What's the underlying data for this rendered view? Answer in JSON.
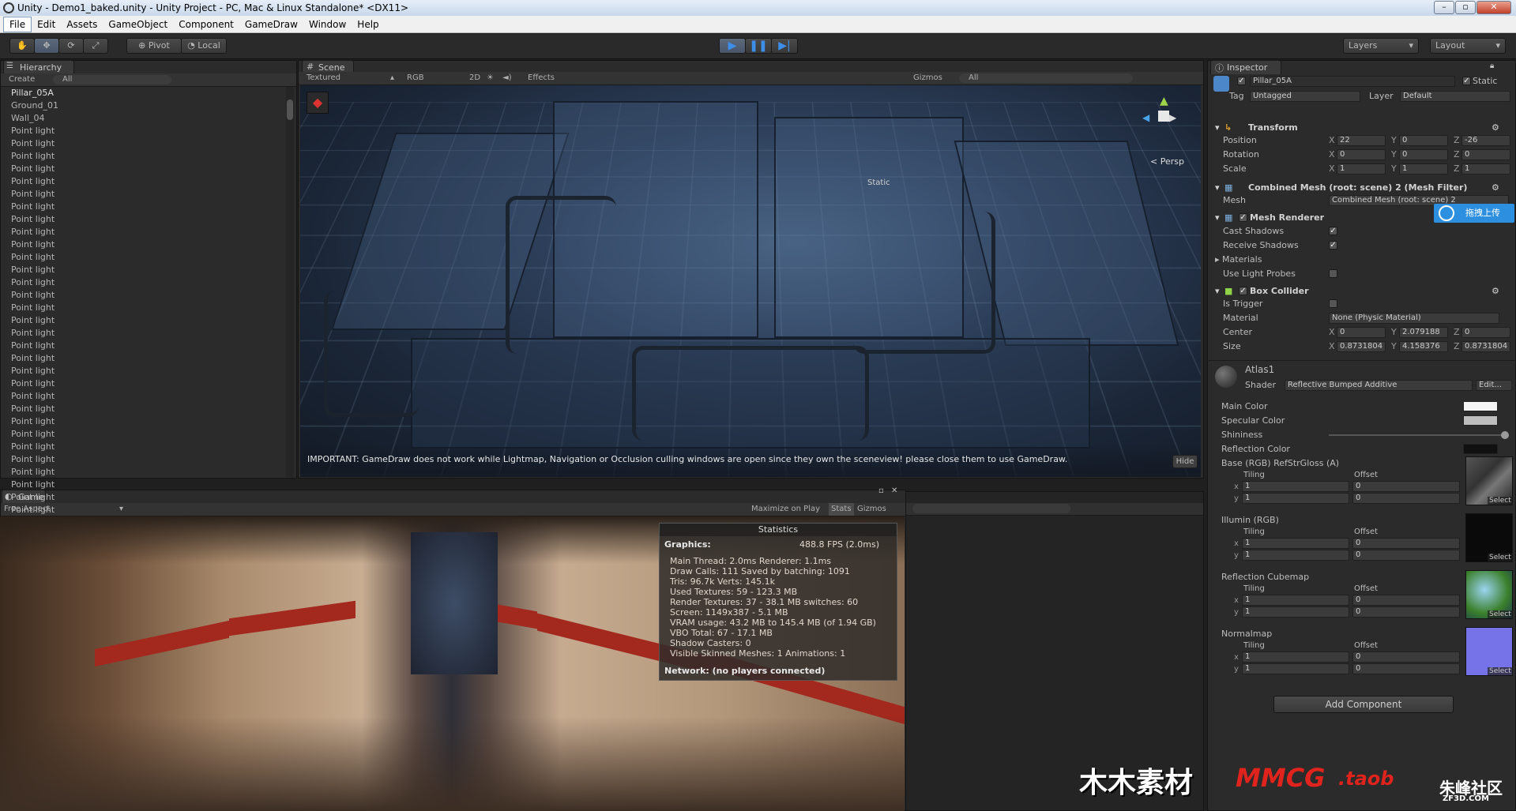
{
  "window": {
    "title": "Unity - Demo1_baked.unity - Unity Project - PC, Mac & Linux Standalone* <DX11>",
    "controls": [
      "–",
      "▫",
      "✕"
    ]
  },
  "menu": [
    "File",
    "Edit",
    "Assets",
    "GameObject",
    "Component",
    "GameDraw",
    "Window",
    "Help"
  ],
  "toolbar": {
    "pivot": "Pivot",
    "local": "Local",
    "layers": "Layers",
    "layout": "Layout"
  },
  "hierarchy": {
    "tab": "Hierarchy",
    "create": "Create",
    "search_placeholder": "All",
    "items": [
      "Pillar_05A",
      "Ground_01",
      "Wall_04",
      "Point light",
      "Point light",
      "Point light",
      "Point light",
      "Point light",
      "Point light",
      "Point light",
      "Point light",
      "Point light",
      "Point light",
      "Point light",
      "Point light",
      "Point light",
      "Point light",
      "Point light",
      "Point light",
      "Point light",
      "Point light",
      "Point light",
      "Point light",
      "Point light",
      "Point light",
      "Point light",
      "Point light",
      "Point light",
      "Point light",
      "Point light",
      "Point light",
      "Point light",
      "Point light",
      "Point light"
    ]
  },
  "scene": {
    "tab": "Scene",
    "draw_mode": "Textured",
    "color_mode": "RGB",
    "mode_2d": "2D",
    "effects": "Effects",
    "gizmos": "Gizmos",
    "search_placeholder": "All",
    "persp": "< Persp",
    "static_label": "Static",
    "notice": "IMPORTANT: GameDraw does not work while Lightmap, Navigation or Occlusion culling windows are open since they own the sceneview! please close them to use GameDraw.",
    "hide": "Hide"
  },
  "game": {
    "tab": "Game",
    "aspect": "Free Aspect",
    "maximize": "Maximize on Play",
    "stats_btn": "Stats",
    "gizmos": "Gizmos"
  },
  "stats": {
    "title": "Statistics",
    "graphics": "Graphics:",
    "fps": "488.8 FPS (2.0ms)",
    "lines": [
      "Main Thread: 2.0ms  Renderer: 1.1ms",
      "Draw Calls: 111   Saved by batching: 1091",
      "Tris: 96.7k   Verts: 145.1k",
      "Used Textures: 59 - 123.3 MB",
      "Render Textures: 37 - 38.1 MB  switches: 60",
      "Screen: 1149x387 - 5.1 MB",
      "VRAM usage: 43.2 MB to 145.4 MB (of 1.94 GB)",
      "VBO Total: 67 - 17.1 MB",
      "Shadow Casters: 0",
      "Visible Skinned Meshes: 1      Animations: 1"
    ],
    "network": "Network: (no players connected)"
  },
  "inspector": {
    "tab": "Inspector",
    "object_name": "Pillar_05A",
    "static": "Static",
    "tag_label": "Tag",
    "tag_value": "Untagged",
    "layer_label": "Layer",
    "layer_value": "Default",
    "transform": {
      "title": "Transform",
      "position": {
        "label": "Position",
        "x": "22",
        "y": "0",
        "z": "-26"
      },
      "rotation": {
        "label": "Rotation",
        "x": "0",
        "y": "0",
        "z": "0"
      },
      "scale": {
        "label": "Scale",
        "x": "1",
        "y": "1",
        "z": "1"
      }
    },
    "mesh_filter": {
      "title": "Combined Mesh (root: scene) 2 (Mesh Filter)",
      "mesh_label": "Mesh",
      "mesh_value": "Combined Mesh (root: scene) 2"
    },
    "upload_badge": "拖拽上传",
    "mesh_renderer": {
      "title": "Mesh Renderer",
      "cast_shadows": "Cast Shadows",
      "receive_shadows": "Receive Shadows",
      "materials": "Materials",
      "use_light_probes": "Use Light Probes"
    },
    "box_collider": {
      "title": "Box Collider",
      "is_trigger": "Is Trigger",
      "material_label": "Material",
      "material_value": "None (Physic Material)",
      "center": {
        "label": "Center",
        "x": "0",
        "y": "2.079188",
        "z": "0"
      },
      "size": {
        "label": "Size",
        "x": "0.8731804",
        "y": "4.158376",
        "z": "0.8731804"
      }
    },
    "material": {
      "name": "Atlas1",
      "shader_label": "Shader",
      "shader_value": "Reflective Bumped Additive",
      "edit": "Edit...",
      "main_color": "Main Color",
      "specular_color": "Specular Color",
      "shininess": "Shininess",
      "reflection_color": "Reflection Color",
      "tiling": "Tiling",
      "offset": "Offset",
      "select": "Select",
      "textures": [
        {
          "label": "Base (RGB) RefStrGloss (A)",
          "tx": "1",
          "ty": "1",
          "ox": "0",
          "oy": "0"
        },
        {
          "label": "Illumin (RGB)",
          "tx": "1",
          "ty": "1",
          "ox": "0",
          "oy": "0"
        },
        {
          "label": "Reflection Cubemap",
          "tx": "1",
          "ty": "1",
          "ox": "0",
          "oy": "0"
        },
        {
          "label": "Normalmap",
          "tx": "1",
          "ty": "1",
          "ox": "0",
          "oy": "0"
        }
      ]
    },
    "add_component": "Add Component"
  },
  "watermarks": {
    "left": "木木素材",
    "mmcg": "MMCG",
    "taob": ".taob",
    "right": "朱峰社区",
    "right_sub": "ZF3D.COM"
  },
  "colors": {
    "accent": "#3d8ee8",
    "panel": "#2b2b2b",
    "stripe": "#a3281e",
    "mmcg": "#e0231c"
  }
}
